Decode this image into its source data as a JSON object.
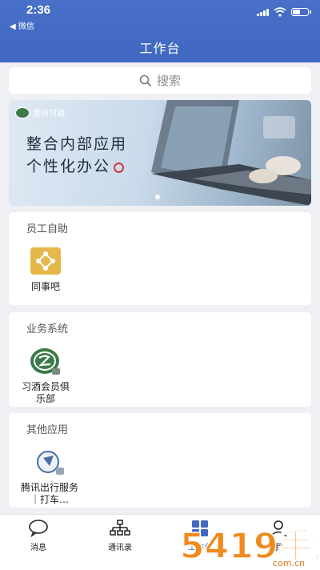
{
  "status": {
    "time": "2:36",
    "back_label": "◀ 微信"
  },
  "header": {
    "title": "工作台"
  },
  "search": {
    "placeholder": "搜索"
  },
  "banner": {
    "brand": "贵州习酒",
    "line1": "整合内部应用",
    "line2": "个性化办公"
  },
  "sections": [
    {
      "title": "员工自助",
      "app_label": "同事吧",
      "icon": "share-nodes-icon",
      "color": "#e6b84a"
    },
    {
      "title": "业务系统",
      "app_label": "习酒会员俱乐部",
      "icon": "xijiu-logo-icon",
      "color": "#3c7a4a"
    },
    {
      "title": "其他应用",
      "app_label": "腾讯出行服务｜打车…",
      "icon": "compass-icon",
      "color": "#4a6fa5"
    }
  ],
  "tabs": [
    {
      "label": "消息",
      "icon": "chat-bubble-icon"
    },
    {
      "label": "通讯录",
      "icon": "org-chart-icon"
    },
    {
      "label": "工作台",
      "icon": "grid-icon",
      "active": true
    },
    {
      "label": "我",
      "icon": "user-icon"
    }
  ],
  "watermark": {
    "text": "5419手游网",
    "url_text": "com.cn"
  },
  "colors": {
    "brand_blue": "#4068c0",
    "background": "#eef0f4"
  }
}
